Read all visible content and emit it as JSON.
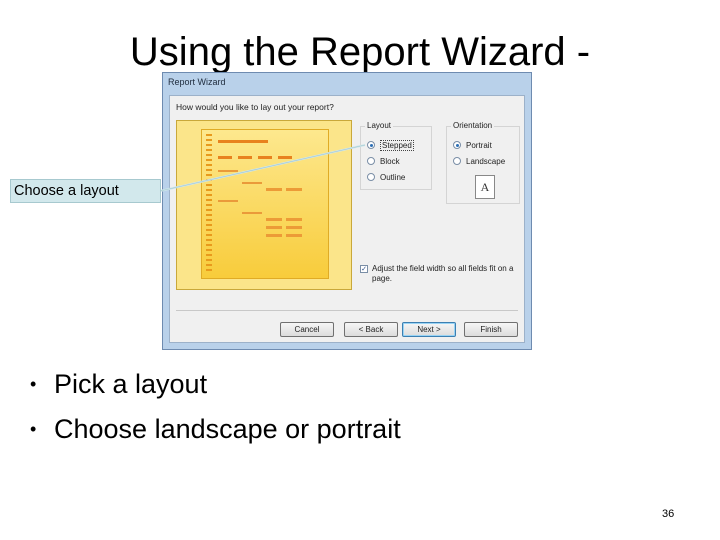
{
  "slide": {
    "title": "Using the Report Wizard -",
    "page_number": "36"
  },
  "callout": {
    "text": "Choose a layout"
  },
  "dialog": {
    "title": "Report Wizard",
    "question": "How would you like to lay out your report?",
    "layout_group": {
      "label": "Layout",
      "options": [
        "Stepped",
        "Block",
        "Outline"
      ],
      "selected": "Stepped"
    },
    "orientation_group": {
      "label": "Orientation",
      "options": [
        "Portrait",
        "Landscape"
      ],
      "selected": "Portrait",
      "icon_letter": "A"
    },
    "adjust_checkbox": {
      "label": "Adjust the field width so all fields fit on a page.",
      "checked": true
    },
    "buttons": {
      "cancel": "Cancel",
      "back": "< Back",
      "next": "Next >",
      "finish": "Finish"
    }
  },
  "bullets": [
    "Pick a layout",
    "Choose landscape or portrait"
  ]
}
